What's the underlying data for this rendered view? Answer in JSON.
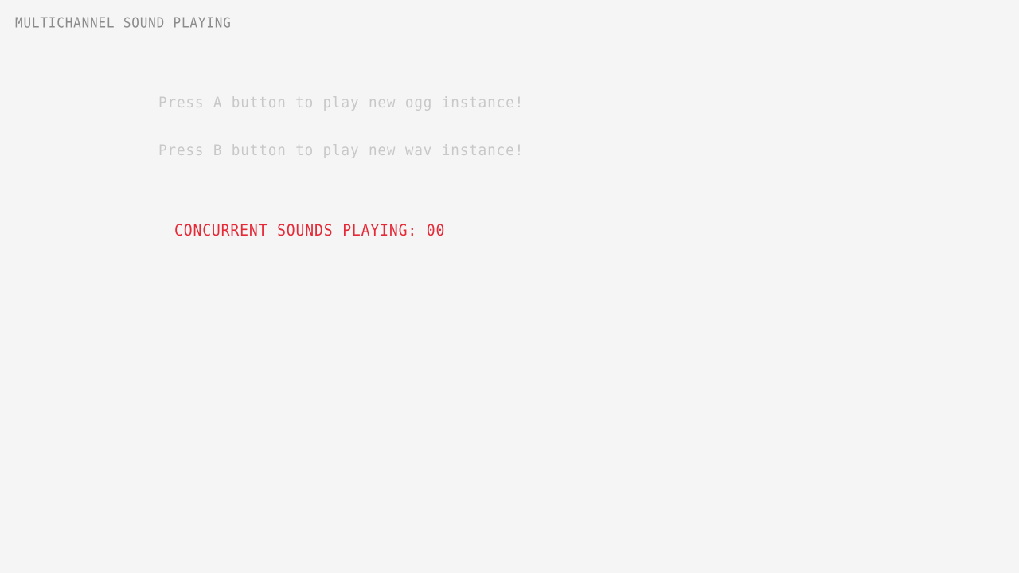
{
  "window": {
    "title": "MULTICHANNEL SOUND PLAYING",
    "background_color": "#f5f5f5"
  },
  "instructions": {
    "play_ogg": "Press A button to play new ogg instance!",
    "play_wav": "Press B button to play new wav instance!"
  },
  "status": {
    "concurrent_sounds_text": "CONCURRENT SOUNDS PLAYING: 00",
    "concurrent_sounds_count": 0
  },
  "colors": {
    "title_text": "#8b8b8b",
    "instruction_text": "#c8c8c8",
    "counter_text": "#e62937"
  }
}
